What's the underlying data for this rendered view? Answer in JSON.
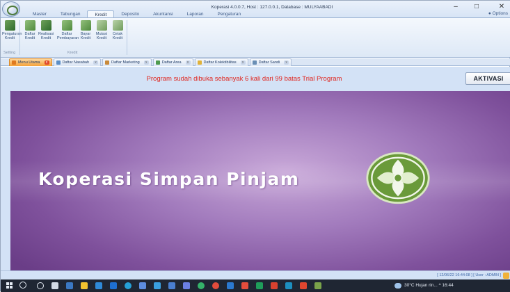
{
  "window": {
    "title": "Koperasi 4.0.0.7, Host : 127.0.0.1, Database : MULYAABADI",
    "minimize": "–",
    "maximize": "□",
    "close": "✕",
    "options_label": "Options"
  },
  "ribbon_tabs": [
    "Master",
    "Tabungan",
    "Kredit",
    "Deposito",
    "Akuntansi",
    "Laporan",
    "Pengaturan"
  ],
  "ribbon": {
    "buttons": [
      {
        "line1": "Pengaturan",
        "line2": "Kredit",
        "icon": "settings-credit-icon"
      },
      {
        "line1": "Daftar",
        "line2": "Kredit",
        "icon": "credit-list-icon"
      },
      {
        "line1": "Realisasi",
        "line2": "Kredit",
        "icon": "credit-realization-icon"
      },
      {
        "line1": "Daftar",
        "line2": "Pembayaran",
        "icon": "payment-list-icon"
      },
      {
        "line1": "Bayar",
        "line2": "Kredit",
        "icon": "pay-credit-icon"
      },
      {
        "line1": "Mutasi",
        "line2": "Kredit",
        "icon": "credit-mutation-icon"
      },
      {
        "line1": "Cetak",
        "line2": "Kredit",
        "icon": "print-credit-icon"
      }
    ],
    "groups": [
      "Setting",
      "Kredit"
    ]
  },
  "doc_tabs": [
    "Menu Utama",
    "Daftar Nasabah",
    "Daftar Marketing",
    "Daftar Area",
    "Daftar Kolektibilitas",
    "Daftar Sandi"
  ],
  "banner": {
    "message": "Program sudah dibuka sebanyak 6 kali dari 99 batas Trial Program",
    "activate_label": "AKTIVASI"
  },
  "splash": {
    "title": "Koperasi Simpan Pinjam"
  },
  "statusbar": {
    "text": "[ 12/06/22 16:44:08 ]  [ User : ADMIN ]"
  },
  "taskbar": {
    "tray_text": "30°C  Hujan rin...  ^  16:44"
  },
  "colors": {
    "banner_text": "#e0261f",
    "splash_purple": "#7f519c",
    "logo_green": "#6a9a3a"
  }
}
